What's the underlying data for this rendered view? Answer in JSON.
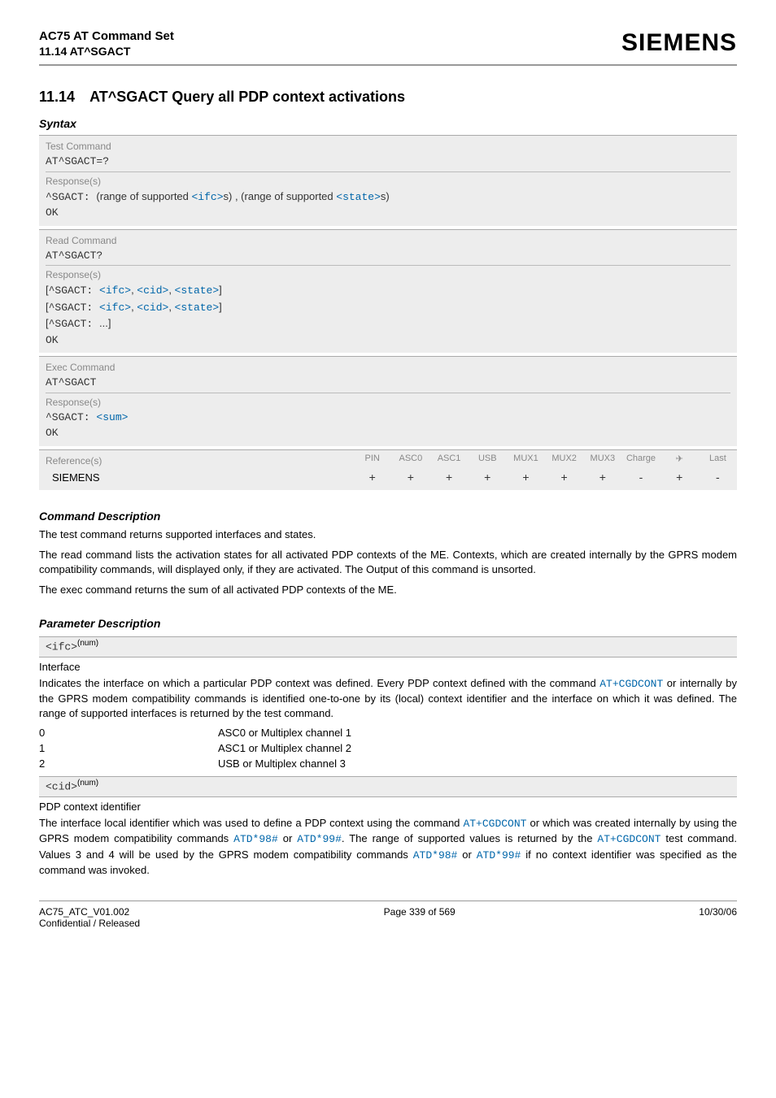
{
  "header": {
    "title": "AC75 AT Command Set",
    "subtitle": "11.14 AT^SGACT",
    "logo": "SIEMENS"
  },
  "section": {
    "number": "11.14",
    "title": "AT^SGACT   Query all PDP context activations"
  },
  "syntax": {
    "label": "Syntax",
    "test": {
      "label": "Test Command",
      "cmd": "AT^SGACT=?",
      "resp_label": "Response(s)",
      "resp_prefix": "^SGACT:",
      "resp_mid1": "(range of supported ",
      "resp_p1": "<ifc>",
      "resp_mid2": "s) , (range of supported ",
      "resp_p2": "<state>",
      "resp_mid3": "s)",
      "ok": "OK"
    },
    "read": {
      "label": "Read Command",
      "cmd": "AT^SGACT?",
      "resp_label": "Response(s)",
      "line1_pre": "[",
      "line1_tag": "^SGACT: ",
      "line1_p1": "<ifc>",
      "line1_p2": "<cid>",
      "line1_p3": "<state>",
      "line1_post": "]",
      "line3": "[^SGACT: ...]",
      "ok": "OK"
    },
    "exec": {
      "label": "Exec Command",
      "cmd": "AT^SGACT",
      "resp_label": "Response(s)",
      "resp_prefix": "^SGACT: ",
      "resp_p1": "<sum>",
      "ok": "OK"
    }
  },
  "refs": {
    "label": "Reference(s)",
    "cols": [
      "PIN",
      "ASC0",
      "ASC1",
      "USB",
      "MUX1",
      "MUX2",
      "MUX3",
      "Charge",
      "✈",
      "Last"
    ],
    "row_label": "SIEMENS",
    "row_vals": [
      "+",
      "+",
      "+",
      "+",
      "+",
      "+",
      "+",
      "-",
      "+",
      "-"
    ]
  },
  "cmd_desc": {
    "label": "Command Description",
    "p1": "The test command returns supported interfaces and states.",
    "p2": "The read command lists the activation states for all activated PDP contexts of the ME. Contexts, which are created internally by the GPRS modem compatibility commands, will displayed only, if they are activated. The Output of this command is unsorted.",
    "p3": "The exec command returns the sum of all activated PDP contexts of the ME."
  },
  "param_desc": {
    "label": "Parameter Description",
    "ifc": {
      "name": "<ifc>",
      "sup": "(num)",
      "title": "Interface",
      "body_pre": "Indicates the interface on which a particular PDP context was defined. Every PDP context defined with the command ",
      "body_link1": "AT+CGDCONT",
      "body_mid": " or internally by the GPRS modem compatibility commands is identified one-to-one by its (local) context identifier and the interface on which it was defined. The range of supported interfaces is returned by the test command.",
      "rows": [
        {
          "k": "0",
          "v": "ASC0 or Multiplex channel 1"
        },
        {
          "k": "1",
          "v": "ASC1 or Multiplex channel 2"
        },
        {
          "k": "2",
          "v": "USB or Multiplex channel 3"
        }
      ]
    },
    "cid": {
      "name": "<cid>",
      "sup": "(num)",
      "title": "PDP context identifier",
      "b1": "The interface local identifier which was used to define a PDP context using the command ",
      "l1": "AT+CGDCONT",
      "b2": " or which was created internally by using the GPRS modem compatibility commands ",
      "l2": "ATD*98#",
      "b3": " or ",
      "l3": "ATD*99#",
      "b4": ". The range of supported values is returned by the ",
      "l4": "AT+CGDCONT",
      "b5": " test command. Values 3 and 4 will be used by the GPRS modem compatibility commands ",
      "l5": "ATD*98#",
      "b6": " or ",
      "l6": "ATD*99#",
      "b7": " if no context identifier was specified as the command was invoked."
    }
  },
  "footer": {
    "left1": "AC75_ATC_V01.002",
    "left2": "Confidential / Released",
    "center": "Page 339 of 569",
    "right": "10/30/06"
  }
}
